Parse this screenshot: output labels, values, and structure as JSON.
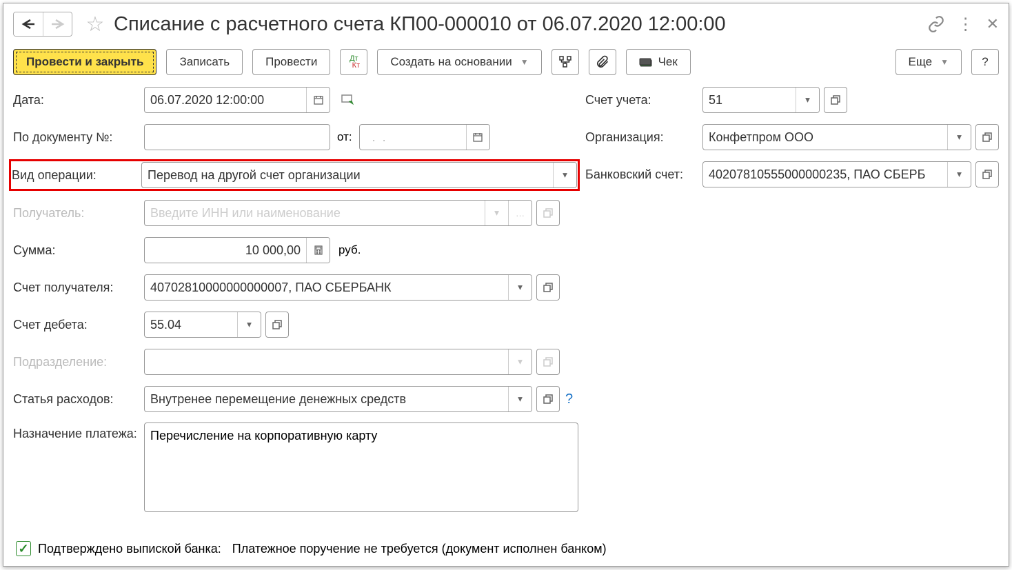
{
  "title": "Списание с расчетного счета КП00-000010 от 06.07.2020 12:00:00",
  "toolbar": {
    "post_close": "Провести и закрыть",
    "save": "Записать",
    "post": "Провести",
    "create_based": "Создать на основании",
    "check": "Чек",
    "more": "Еще",
    "help": "?"
  },
  "labels": {
    "date": "Дата:",
    "docnum": "По документу №:",
    "docnum_from": "от:",
    "op_type": "Вид операции:",
    "recipient": "Получатель:",
    "amount": "Сумма:",
    "recipient_account": "Счет получателя:",
    "debit_account": "Счет дебета:",
    "division": "Подразделение:",
    "expense_item": "Статья расходов:",
    "purpose": "Назначение платежа:",
    "account": "Счет учета:",
    "organization": "Организация:",
    "bank_account": "Банковский счет:",
    "currency": "руб."
  },
  "values": {
    "date": "06.07.2020 12:00:00",
    "docnum": "",
    "docnum_from": "  .  .",
    "op_type": "Перевод на другой счет организации",
    "recipient_placeholder": "Введите ИНН или наименование",
    "amount": "10 000,00",
    "recipient_account": "40702810000000000007, ПАО СБЕРБАНК",
    "debit_account": "55.04",
    "division": "",
    "expense_item": "Внутренее перемещение денежных средств",
    "purpose": "Перечисление на корпоративную карту",
    "account": "51",
    "organization": "Конфетпром ООО",
    "bank_account": "40207810555000000235, ПАО СБЕРБ"
  },
  "footer": {
    "confirmed_label": "Подтверждено выпиской банка:",
    "confirmed_text": "Платежное поручение не требуется (документ исполнен банком)"
  }
}
